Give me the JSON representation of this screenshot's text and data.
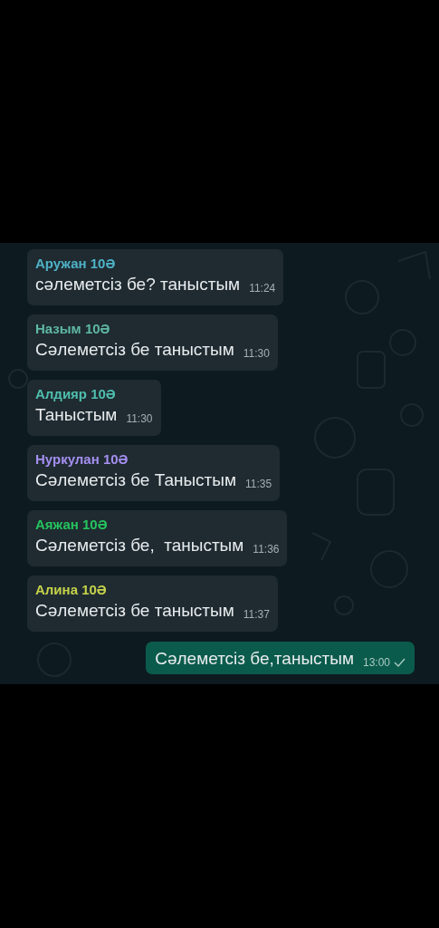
{
  "messages": [
    {
      "kind": "incoming",
      "sender": "Аружан 10Ә",
      "color": "#4fb3c8",
      "text": "сәлеметсіз бе? таныстым",
      "time": "11:24"
    },
    {
      "kind": "incoming",
      "sender": "Назым 10Ә",
      "color": "#5fb8a6",
      "text": "Сәлеметсіз бе таныстым",
      "time": "11:30"
    },
    {
      "kind": "incoming",
      "sender": "Алдияр 10Ә",
      "color": "#4fbfae",
      "text": "Таныстым",
      "time": "11:30"
    },
    {
      "kind": "incoming",
      "sender": "Нуркулан 10Ә",
      "color": "#a58ff0",
      "text": "Сәлеметсіз бе Таныстым",
      "time": "11:35"
    },
    {
      "kind": "incoming",
      "sender": "Аяжан 10Ә",
      "color": "#25c45e",
      "text": "Сәлеметсіз бе,  таныстым",
      "time": "11:36"
    },
    {
      "kind": "incoming",
      "sender": "Алина 10Ә",
      "color": "#c6d24a",
      "text": "Сәлеметсіз бе таныстым",
      "time": "11:37"
    },
    {
      "kind": "outgoing",
      "text": "Сәлеметсіз бе,таныстым",
      "time": "13:00",
      "read": false
    }
  ]
}
